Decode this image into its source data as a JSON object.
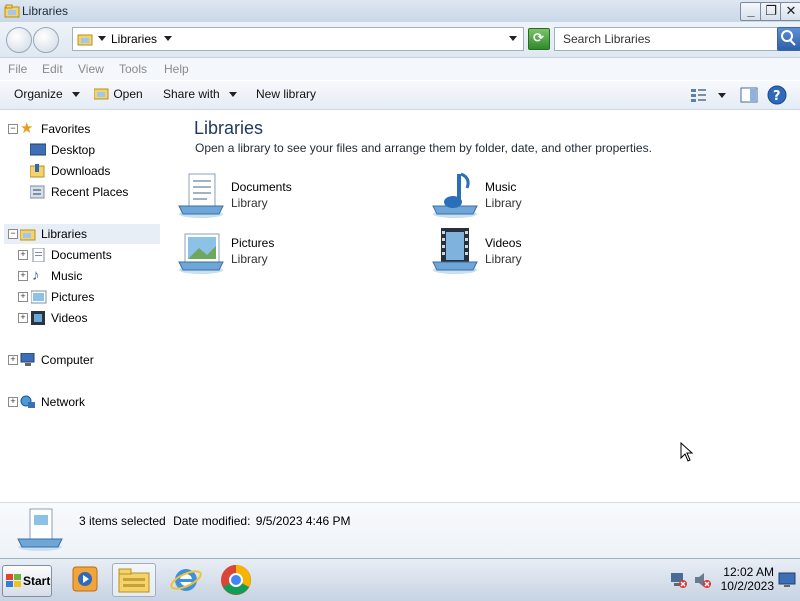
{
  "window": {
    "title": "Libraries",
    "buttons": {
      "minimize": "_",
      "maximize": "❐",
      "close": "✕"
    }
  },
  "address_bar": {
    "path_label": "Libraries",
    "search_placeholder": "Search Libraries"
  },
  "menu": [
    "File",
    "Edit",
    "View",
    "Tools",
    "Help"
  ],
  "commands": {
    "organize": "Organize",
    "open": "Open",
    "share_with": "Share with",
    "new_library": "New library"
  },
  "nav_pane": {
    "favorites": {
      "label": "Favorites",
      "items": [
        "Desktop",
        "Downloads",
        "Recent Places"
      ]
    },
    "libraries": {
      "label": "Libraries",
      "items": [
        "Documents",
        "Music",
        "Pictures",
        "Videos"
      ]
    },
    "computer": "Computer",
    "network": "Network"
  },
  "main": {
    "title": "Libraries",
    "subtitle": "Open a library to see your files and arrange them by folder, date, and other properties.",
    "libraries": [
      {
        "name": "Documents",
        "type": "Library",
        "icon": "documents-library-icon"
      },
      {
        "name": "Music",
        "type": "Library",
        "icon": "music-library-icon"
      },
      {
        "name": "Pictures",
        "type": "Library",
        "icon": "pictures-library-icon"
      },
      {
        "name": "Videos",
        "type": "Library",
        "icon": "videos-library-icon"
      }
    ]
  },
  "details": {
    "summary": "3 items selected",
    "date_label": "Date modified:",
    "date_value": "9/5/2023 4:46 PM"
  },
  "taskbar": {
    "start_label": "Start",
    "time": "12:02 AM",
    "date": "10/2/2023"
  },
  "colors": {
    "accent": "#1f3a60",
    "selection": "#e8eef6"
  }
}
